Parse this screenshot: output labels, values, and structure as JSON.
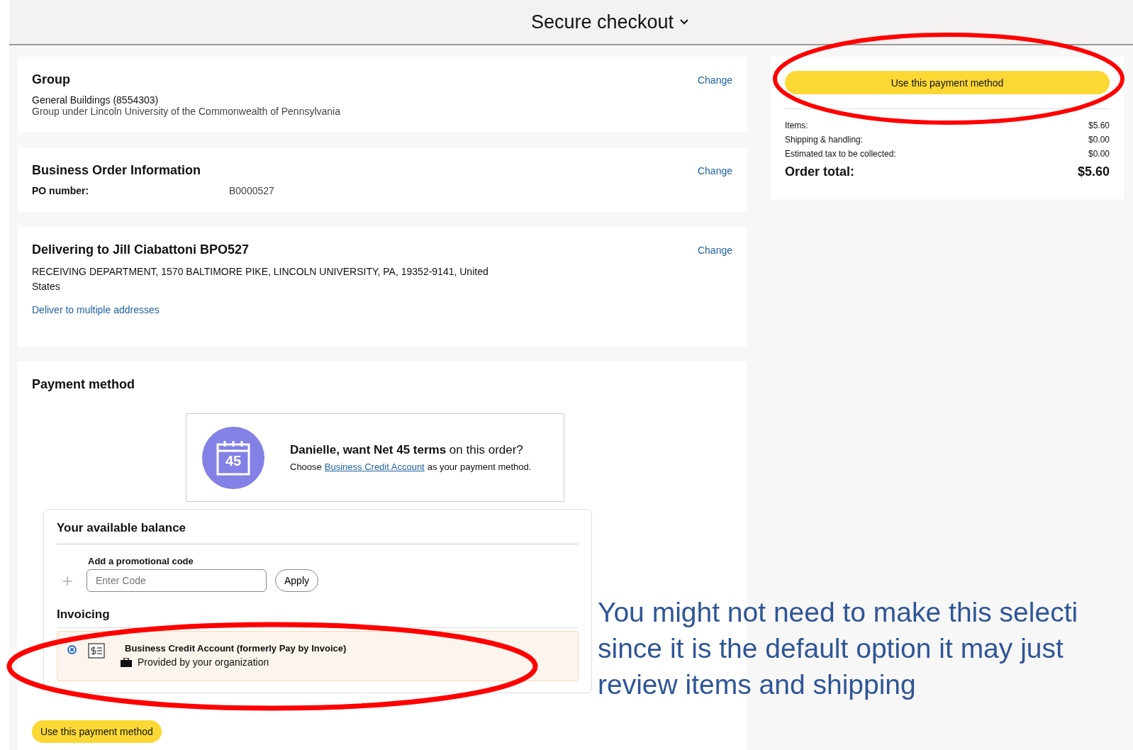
{
  "header": {
    "title": "Secure checkout"
  },
  "group": {
    "heading": "Group",
    "change": "Change",
    "name": "General Buildings (8554303)",
    "description": "Group under Lincoln University of the Commonwealth of Pennsylvania"
  },
  "business_order": {
    "heading": "Business Order Information",
    "change": "Change",
    "po_label": "PO number:",
    "po_value": "B0000527"
  },
  "delivery": {
    "heading": "Delivering to Jill Ciabattoni BPO527",
    "change": "Change",
    "address": "RECEIVING DEPARTMENT, 1570 BALTIMORE PIKE, LINCOLN UNIVERSITY, PA, 19352-9141, United States",
    "multi_link": "Deliver to multiple addresses"
  },
  "payment": {
    "heading": "Payment method",
    "promo": {
      "icon_number": "45",
      "headline": "**Danielle, want Net 45 terms** on this order?",
      "choose": "Choose",
      "link": "Business Credit Account",
      "after": "as your payment method."
    },
    "balance": {
      "heading": "Your available balance",
      "promo_label": "Add a promotional code",
      "plus": "+",
      "placeholder": "Enter Code",
      "apply": "Apply"
    },
    "invoicing": {
      "heading": "Invoicing",
      "options": [
        {
          "title": "Business Credit Account (formerly Pay by Invoice)",
          "subtitle": "Provided by your organization",
          "selected": true
        }
      ]
    },
    "button": "Use this payment method"
  },
  "summary": {
    "button": "Use this payment method",
    "rows": [
      {
        "label": "Items:",
        "value": "$5.60"
      },
      {
        "label": "Shipping & handling:",
        "value": "$0.00"
      },
      {
        "label": "Estimated tax to be collected:",
        "value": "$0.00"
      }
    ],
    "total": {
      "label": "Order total:",
      "value": "$5.60"
    }
  },
  "annotation": {
    "lines": [
      "You might not need to make this selecti",
      "since it is the default option it may just",
      "review items and shipping"
    ]
  }
}
